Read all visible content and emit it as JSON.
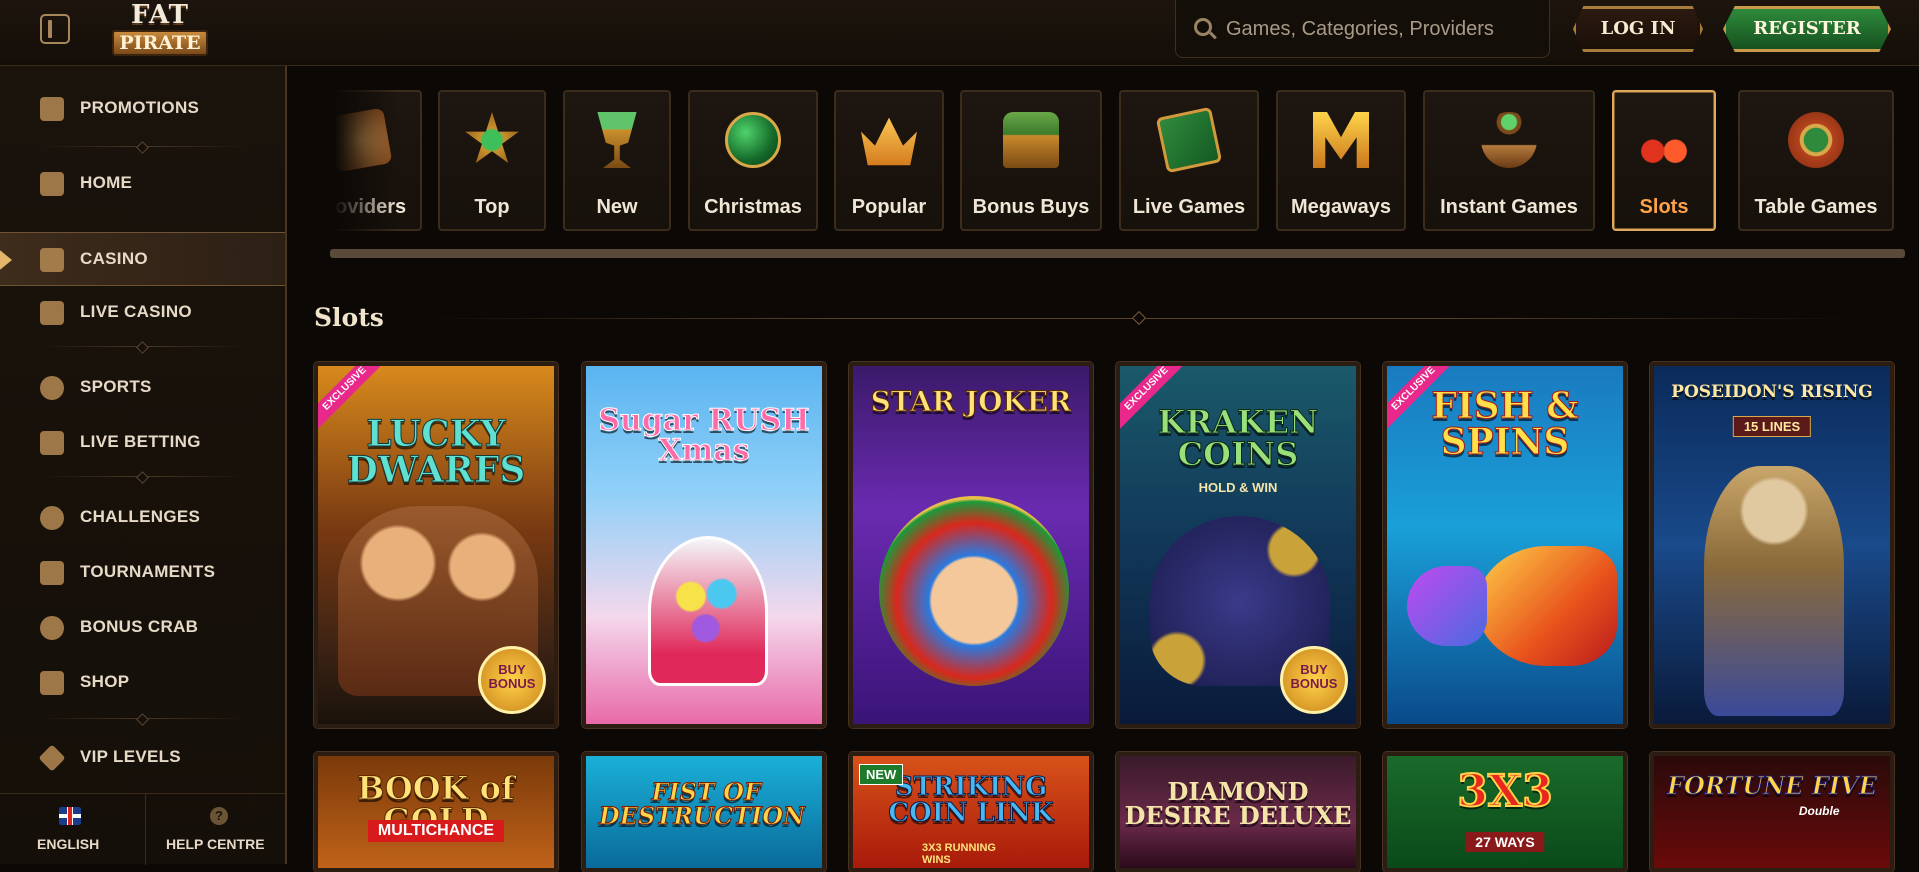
{
  "header": {
    "logo_top": "FAT",
    "logo_bottom": "PIRATE",
    "search_placeholder": "Games, Categories, Providers",
    "login_label": "LOG IN",
    "register_label": "REGISTER"
  },
  "sidebar": {
    "items": [
      {
        "label": "PROMOTIONS"
      },
      {
        "label": "HOME"
      },
      {
        "label": "CASINO"
      },
      {
        "label": "LIVE CASINO"
      },
      {
        "label": "SPORTS"
      },
      {
        "label": "LIVE BETTING"
      },
      {
        "label": "CHALLENGES"
      },
      {
        "label": "TOURNAMENTS"
      },
      {
        "label": "BONUS CRAB"
      },
      {
        "label": "SHOP"
      },
      {
        "label": "VIP LEVELS"
      }
    ],
    "language_label": "ENGLISH",
    "help_label": "HELP CENTRE"
  },
  "categories": [
    {
      "label": "Providers",
      "icon": "scroll-icon"
    },
    {
      "label": "Top",
      "icon": "star-icon"
    },
    {
      "label": "New",
      "icon": "goblet-icon"
    },
    {
      "label": "Christmas",
      "icon": "ornament-icon"
    },
    {
      "label": "Popular",
      "icon": "crown-icon"
    },
    {
      "label": "Bonus Buys",
      "icon": "chest-icon"
    },
    {
      "label": "Live Games",
      "icon": "cards-icon"
    },
    {
      "label": "Megaways",
      "icon": "megaways-icon"
    },
    {
      "label": "Instant Games",
      "icon": "joystick-icon"
    },
    {
      "label": "Slots",
      "icon": "cherries-icon"
    },
    {
      "label": "Table Games",
      "icon": "club-chip-icon"
    }
  ],
  "section_title": "Slots",
  "games_row1": [
    {
      "title": "LUCKY DWARFS",
      "badge": "EXCLUSIVE",
      "bonus": "BUY BONUS"
    },
    {
      "title": "Sugar RUSH Xmas"
    },
    {
      "title": "STAR JOKER"
    },
    {
      "title": "KRAKEN COINS",
      "sub": "HOLD & WIN",
      "badge": "EXCLUSIVE",
      "bonus": "BUY BONUS"
    },
    {
      "title": "FISH & SPINS",
      "badge": "EXCLUSIVE"
    },
    {
      "title": "POSEIDON'S RISING",
      "sub": "15 LINES"
    }
  ],
  "games_row2": [
    {
      "title": "BOOK of GOLD",
      "sub": "MULTICHANCE"
    },
    {
      "title": "FIST OF DESTRUCTION"
    },
    {
      "title": "STRIKING COIN LINK",
      "sub": "3X3 RUNNING WINS",
      "badge": "NEW"
    },
    {
      "title": "DIAMOND DESIRE DELUXE"
    },
    {
      "title": "3X3",
      "sub": "27 WAYS"
    },
    {
      "title": "FORTUNE FIVE",
      "sub": "Double"
    }
  ]
}
